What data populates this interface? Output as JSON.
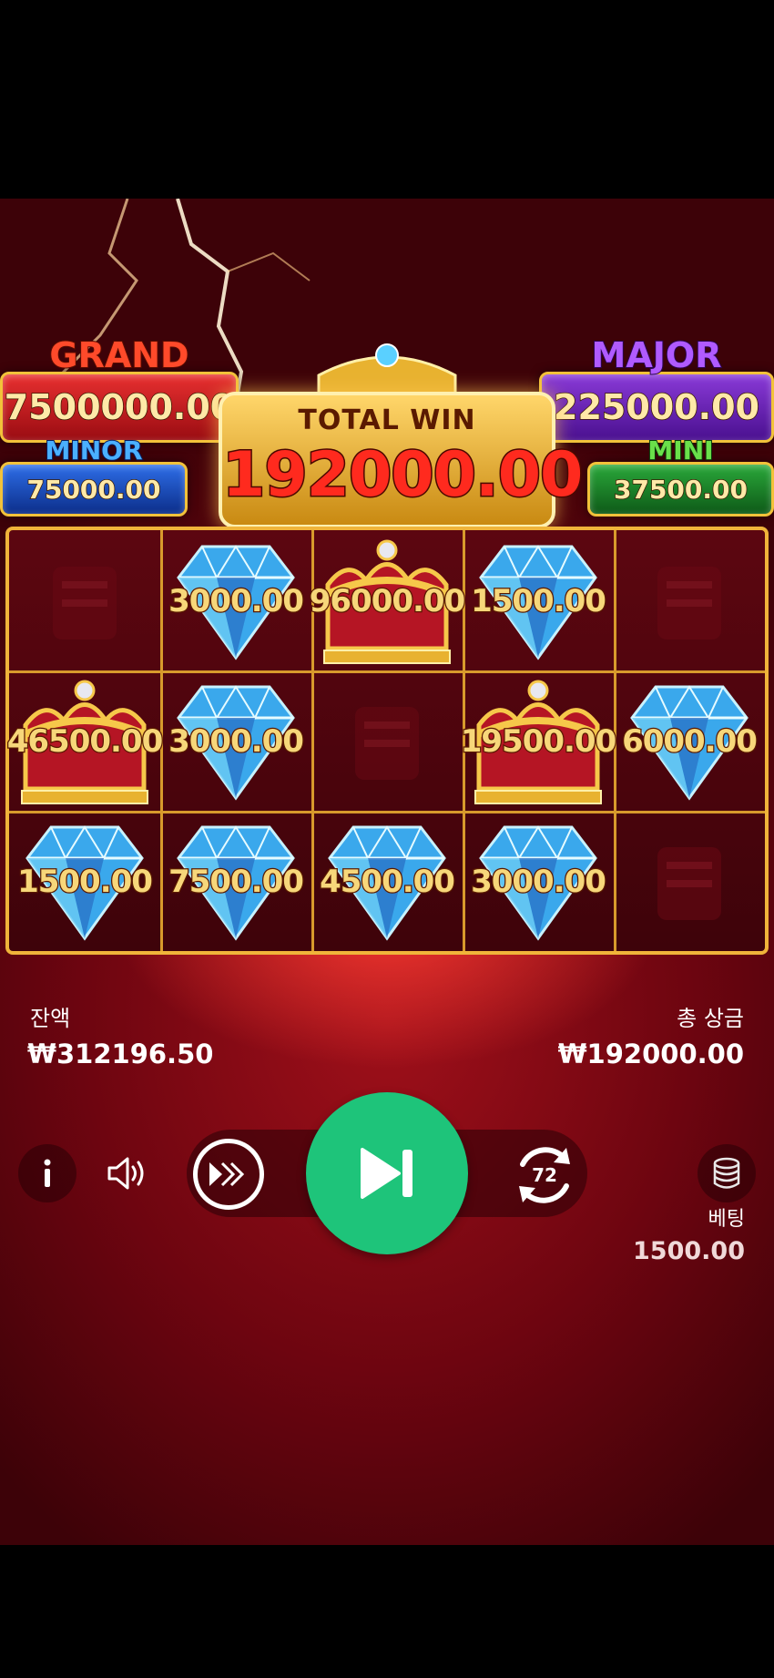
{
  "jackpots": {
    "grand": {
      "title": "GRAND",
      "value": "7500000.00"
    },
    "major": {
      "title": "MAJOR",
      "value": "225000.00"
    },
    "minor": {
      "title": "MINOR",
      "value": "75000.00"
    },
    "mini": {
      "title": "MINI",
      "value": "37500.00"
    }
  },
  "total_win": {
    "label": "TOTAL WIN",
    "value": "192000.00"
  },
  "reels": {
    "rows": [
      [
        {
          "symbol": "empty",
          "value": ""
        },
        {
          "symbol": "diamond",
          "value": "3000.00"
        },
        {
          "symbol": "crown",
          "value": "96000.00"
        },
        {
          "symbol": "diamond",
          "value": "1500.00"
        },
        {
          "symbol": "empty",
          "value": ""
        }
      ],
      [
        {
          "symbol": "crown",
          "value": "46500.00"
        },
        {
          "symbol": "diamond",
          "value": "3000.00"
        },
        {
          "symbol": "empty",
          "value": ""
        },
        {
          "symbol": "crown",
          "value": "19500.00"
        },
        {
          "symbol": "diamond",
          "value": "6000.00"
        }
      ],
      [
        {
          "symbol": "diamond",
          "value": "1500.00"
        },
        {
          "symbol": "diamond",
          "value": "7500.00"
        },
        {
          "symbol": "diamond",
          "value": "4500.00"
        },
        {
          "symbol": "diamond",
          "value": "3000.00"
        },
        {
          "symbol": "empty",
          "value": ""
        }
      ]
    ]
  },
  "balance": {
    "label": "잔액",
    "value": "₩312196.50"
  },
  "total_prize": {
    "label": "총 상금",
    "value": "₩192000.00"
  },
  "controls": {
    "info_icon": "info-icon",
    "sound_icon": "speaker-icon",
    "turbo_icon": "fast-forward-icon",
    "spin_icon": "skip-play-icon",
    "autoplay_icon": "autoplay-icon",
    "autoplay_count": "72",
    "bet_icon": "coin-stack-icon"
  },
  "bet": {
    "label": "베팅",
    "value": "1500.00"
  },
  "colors": {
    "spin_button": "#1ec47a",
    "grand_box": "#c8151b",
    "major_box": "#6a1fb8",
    "minor_box": "#1a4fc4",
    "mini_box": "#148a2a",
    "frame_gold": "#f0b43a"
  }
}
